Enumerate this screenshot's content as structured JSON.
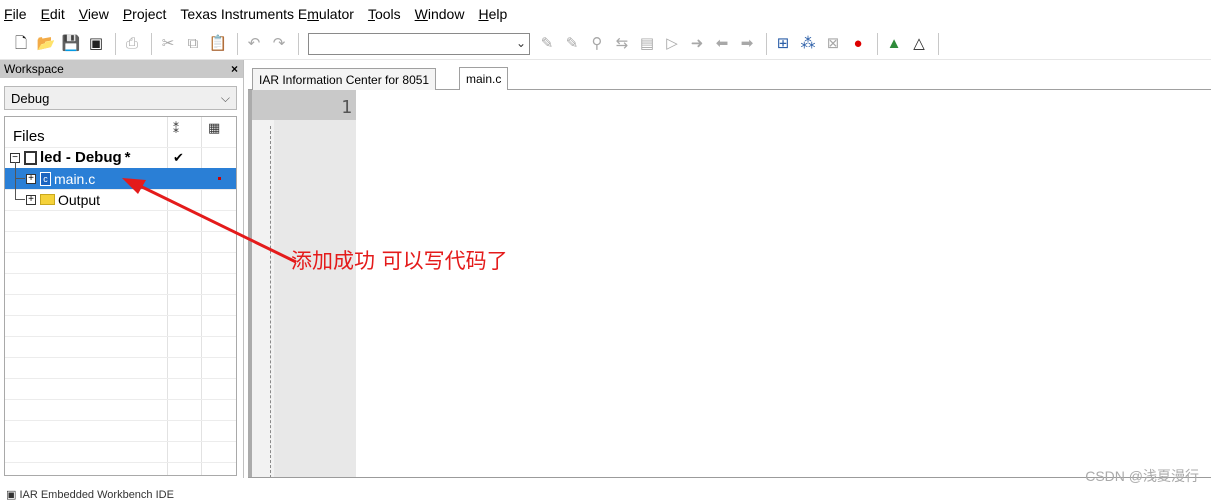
{
  "menubar": {
    "items": [
      {
        "label": "File",
        "ul": "F",
        "rest": "ile"
      },
      {
        "label": "Edit",
        "ul": "E",
        "rest": "dit"
      },
      {
        "label": "View",
        "ul": "V",
        "rest": "iew"
      },
      {
        "label": "Project",
        "ul": "P",
        "rest": "roject"
      },
      {
        "label": "Texas Instruments Emulator",
        "pre": "Texas Instruments E",
        "ul": "m",
        "rest": "ulator"
      },
      {
        "label": "Tools",
        "ul": "T",
        "rest": "ools"
      },
      {
        "label": "Window",
        "ul": "W",
        "rest": "indow"
      },
      {
        "label": "Help",
        "ul": "H",
        "rest": "elp"
      }
    ]
  },
  "toolbar": {
    "new_file_icon": "new-file-icon",
    "find_value": ""
  },
  "workspace": {
    "title": "Workspace",
    "close_glyph": "×",
    "config_value": "Debug",
    "files_header": "Files",
    "project": {
      "name": "led - Debug",
      "modified": "*",
      "check": "✔"
    },
    "items": [
      {
        "name": "main.c",
        "type": "c-file",
        "selected": true
      },
      {
        "name": "Output",
        "type": "folder",
        "selected": false
      }
    ]
  },
  "editor": {
    "tabs": [
      {
        "label": "IAR Information Center for 8051",
        "active": false
      },
      {
        "label": "main.c",
        "active": true
      }
    ],
    "line_numbers": [
      "1"
    ]
  },
  "annotation": {
    "text": "添加成功  可以写代码了",
    "color": "#e41b1b"
  },
  "statusbar": {
    "text": "IAR Embedded Workbench IDE"
  },
  "watermark": "CSDN @浅夏漫行"
}
